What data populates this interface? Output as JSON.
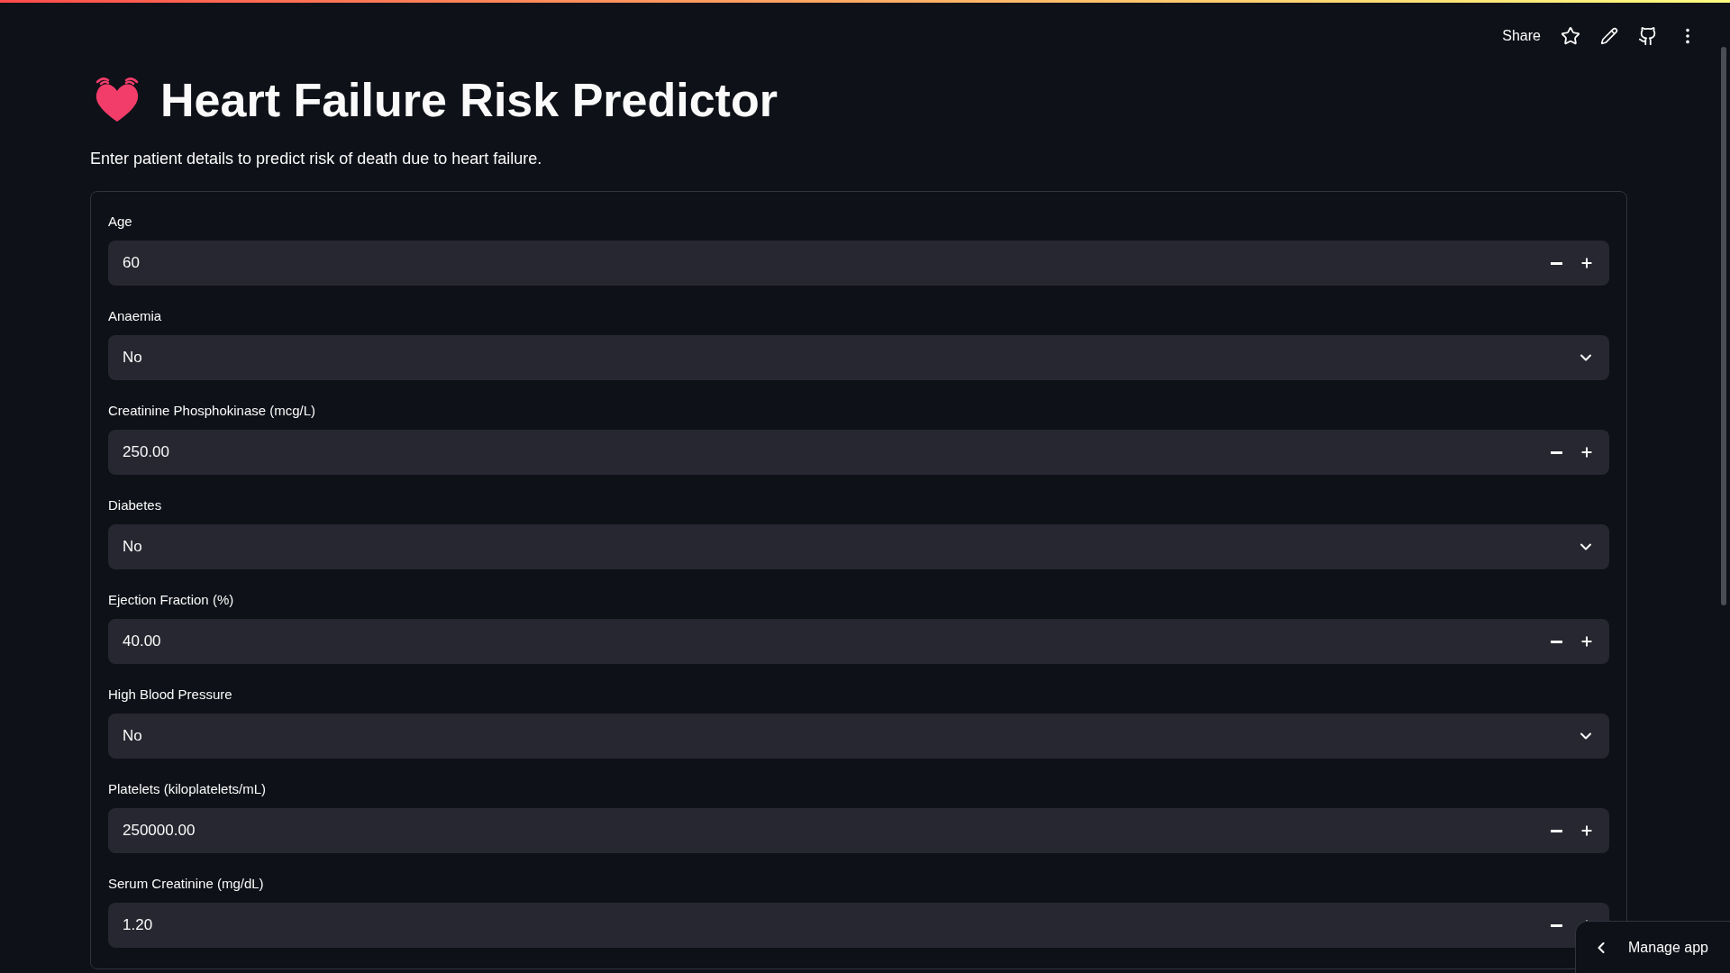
{
  "header": {
    "share": "Share"
  },
  "title": "Heart Failure Risk Predictor",
  "subtitle": "Enter patient details to predict risk of death due to heart failure.",
  "fields": [
    {
      "kind": "number",
      "label": "Age",
      "value": "60"
    },
    {
      "kind": "select",
      "label": "Anaemia",
      "value": "No"
    },
    {
      "kind": "number",
      "label": "Creatinine Phosphokinase (mcg/L)",
      "value": "250.00"
    },
    {
      "kind": "select",
      "label": "Diabetes",
      "value": "No"
    },
    {
      "kind": "number",
      "label": "Ejection Fraction (%)",
      "value": "40.00"
    },
    {
      "kind": "select",
      "label": "High Blood Pressure",
      "value": "No"
    },
    {
      "kind": "number",
      "label": "Platelets (kiloplatelets/mL)",
      "value": "250000.00"
    },
    {
      "kind": "number",
      "label": "Serum Creatinine (mg/dL)",
      "value": "1.20"
    }
  ],
  "manage_app": "Manage app"
}
